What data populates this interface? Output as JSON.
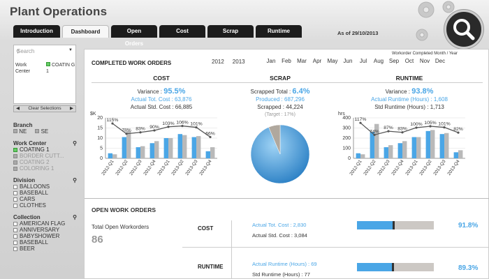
{
  "app": {
    "title": "Plant Operations",
    "as_of": "As of 29/10/2013"
  },
  "tabs": [
    {
      "label": "Introduction",
      "active": false
    },
    {
      "label": "Dashboard",
      "active": true
    },
    {
      "label": "Open Orders",
      "active": false
    },
    {
      "label": "Cost",
      "active": false
    },
    {
      "label": "Scrap",
      "active": false
    },
    {
      "label": "Runtime",
      "active": false
    }
  ],
  "sidebar": {
    "search_placeholder": "Search",
    "filter_field": "Work Center",
    "filter_value": "COATIN G 1",
    "clear_label": "Clear Selections",
    "branch": {
      "title": "Branch",
      "items": [
        "NE",
        "SE"
      ]
    },
    "work_center": {
      "title": "Work Center",
      "items": [
        "COATING 1",
        "BORDER CUTT...",
        "COATING 2",
        "COLORING 1"
      ]
    },
    "division": {
      "title": "Division",
      "items": [
        "BALLOONS",
        "BASEBALL",
        "CARS",
        "CLOTHES"
      ]
    },
    "collection": {
      "title": "Collection",
      "items": [
        "AMERICAN FLAG",
        "ANNIVERSARY",
        "BABYSHOWER",
        "BASEBALL",
        "BEER"
      ]
    }
  },
  "completed": {
    "title": "COMPLETED WORK ORDERS",
    "selector_label": "Workorder Completed Month / Year",
    "years": [
      "2012",
      "2013"
    ],
    "months": [
      "Jan",
      "Feb",
      "Mar",
      "Apr",
      "May",
      "Jun",
      "Jul",
      "Aug",
      "Sep",
      "Oct",
      "Nov",
      "Dec"
    ],
    "cost": {
      "title": "COST",
      "variance_label": "Variance :",
      "variance": "95.5%",
      "actual": "Actual Tot. Cost : 63,876",
      "std": "Actual Std. Cost : 66,885"
    },
    "scrap": {
      "title": "SCRAP",
      "total_label": "Scrapped Total :",
      "total": "6.4%",
      "produced": "Produced : 687,296",
      "scrapped": "Scrapped : 44,224",
      "target": "(Target : 17%)"
    },
    "runtime": {
      "title": "RUNTIME",
      "variance_label": "Variance :",
      "variance": "93.8%",
      "actual": "Actual Runtime (Hours) : 1,608",
      "std": "Std Runtime (Hours) : 1,713"
    }
  },
  "open": {
    "title": "OPEN WORK ORDERS",
    "total_label": "Total Open Workorders",
    "total": "86",
    "cost": {
      "label": "COST",
      "actual": "Actual Tot. Cost : 2,830",
      "std": "Actual Std. Cost : 3,084",
      "pct": "91.8%",
      "fill": 0.47,
      "target": 0.45
    },
    "runtime": {
      "label": "RUNTIME",
      "actual": "Actual Runtime (Hours) : 69",
      "std": "Std Runtime (Hours) : 77",
      "pct": "89.3%",
      "fill": 0.46,
      "target": 0.45
    }
  },
  "colors": {
    "accent": "#4aa6e6",
    "std_bar": "#b9b9b9",
    "line": "#555555",
    "dark_tab": "#1c1c1c"
  },
  "chart_data": [
    {
      "type": "bar",
      "title": "COST",
      "ylabel": "$K",
      "ylim": [
        0,
        20
      ],
      "yticks": [
        0,
        5,
        10,
        15,
        20
      ],
      "categories": [
        "2012-Q1",
        "2012-Q2",
        "2012-Q3",
        "2012-Q4",
        "2013-Q1",
        "2013-Q2",
        "2013-Q3",
        "2013-Q4"
      ],
      "series": [
        {
          "name": "Actual",
          "values": [
            2.5,
            10.5,
            5.5,
            7.5,
            10,
            12,
            10.5,
            3.5
          ]
        },
        {
          "name": "Std",
          "values": [
            2,
            13.5,
            6,
            8.5,
            10,
            11.5,
            11,
            5.5
          ]
        }
      ],
      "line_labels": [
        "115%",
        "78%",
        "83%",
        "90%",
        "103%",
        "106%",
        "101%",
        "66%"
      ],
      "line_values": [
        115,
        78,
        83,
        90,
        103,
        106,
        101,
        66
      ]
    },
    {
      "type": "pie",
      "title": "SCRAP",
      "values": [
        93.6,
        6.4
      ],
      "labels": [
        "Produced",
        "Scrapped"
      ]
    },
    {
      "type": "bar",
      "title": "RUNTIME",
      "ylabel": "hrs",
      "ylim": [
        0,
        400
      ],
      "yticks": [
        0,
        100,
        200,
        300,
        400
      ],
      "categories": [
        "2012-Q1",
        "2012-Q2",
        "2012-Q3",
        "2012-Q4",
        "2013-Q1",
        "2013-Q2",
        "2013-Q3",
        "2013-Q4"
      ],
      "series": [
        {
          "name": "Actual",
          "values": [
            50,
            260,
            110,
            150,
            210,
            270,
            240,
            60
          ]
        },
        {
          "name": "Std",
          "values": [
            40,
            340,
            130,
            170,
            210,
            280,
            250,
            80
          ]
        }
      ],
      "line_labels": [
        "117%",
        "74%",
        "87%",
        "83%",
        "100%",
        "105%",
        "101%",
        "82%"
      ],
      "line_values": [
        117,
        74,
        87,
        83,
        100,
        105,
        101,
        82
      ]
    }
  ]
}
